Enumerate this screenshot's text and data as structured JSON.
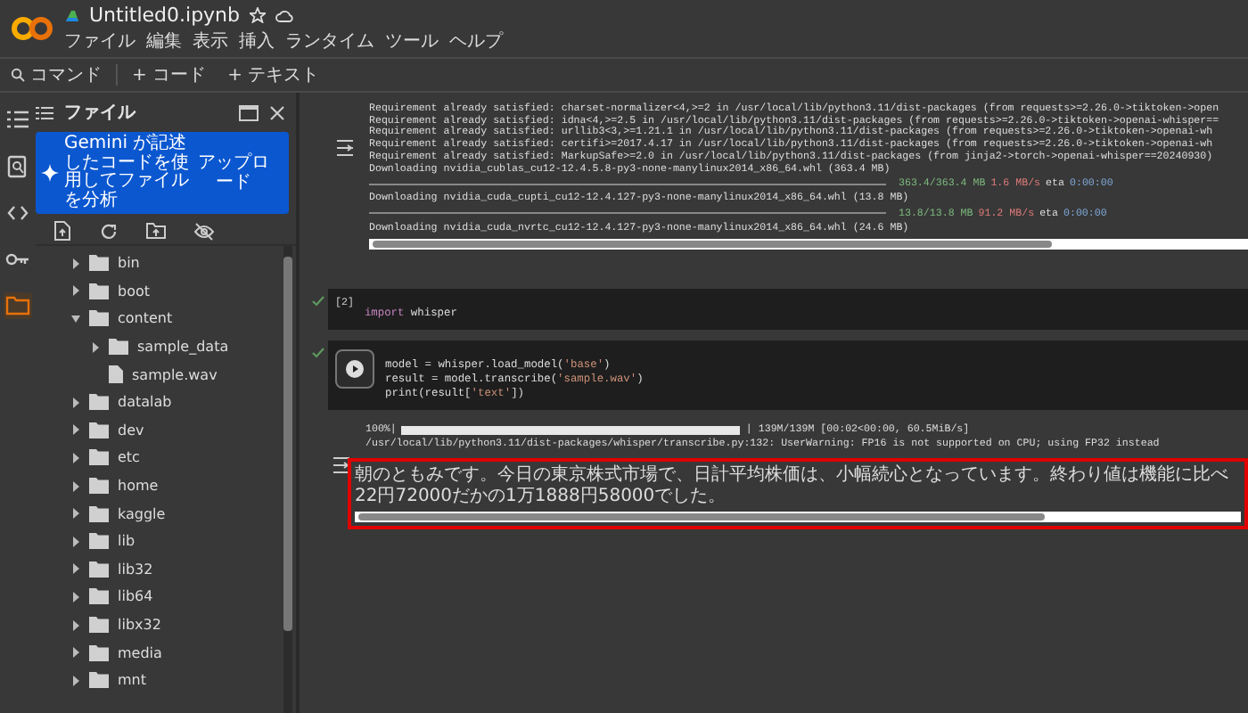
{
  "header": {
    "title": "Untitled0.ipynb",
    "menu": [
      "ファイル",
      "編集",
      "表示",
      "挿入",
      "ランタイム",
      "ツール",
      "ヘルプ"
    ]
  },
  "toolbar": {
    "command": "コマンド",
    "buttons": [
      "+ コード",
      "+ テキスト"
    ]
  },
  "activity_bar": [
    {
      "kind": "toc",
      "selected": false
    },
    {
      "kind": "find",
      "selected": false
    },
    {
      "kind": "code",
      "selected": false
    },
    {
      "kind": "key",
      "selected": false
    },
    {
      "kind": "folder",
      "selected": true
    }
  ],
  "file_panel": {
    "title": "ファイル",
    "gemini": {
      "text": "Gemini が記述したコードを使用してファイルを分析",
      "button": "アップロード"
    },
    "tree": [
      {
        "name": "bin",
        "kind": "folder",
        "expanded": false
      },
      {
        "name": "boot",
        "kind": "folder",
        "expanded": false
      },
      {
        "name": "content",
        "kind": "folder",
        "expanded": true,
        "children": [
          {
            "name": "sample_data",
            "kind": "folder",
            "expanded": false
          },
          {
            "name": "sample.wav",
            "kind": "file"
          }
        ]
      },
      {
        "name": "datalab",
        "kind": "folder",
        "expanded": false
      },
      {
        "name": "dev",
        "kind": "folder",
        "expanded": false
      },
      {
        "name": "etc",
        "kind": "folder",
        "expanded": false
      },
      {
        "name": "home",
        "kind": "folder",
        "expanded": false
      },
      {
        "name": "kaggle",
        "kind": "folder",
        "expanded": false
      },
      {
        "name": "lib",
        "kind": "folder",
        "expanded": false
      },
      {
        "name": "lib32",
        "kind": "folder",
        "expanded": false
      },
      {
        "name": "lib64",
        "kind": "folder",
        "expanded": false
      },
      {
        "name": "libx32",
        "kind": "folder",
        "expanded": false
      },
      {
        "name": "media",
        "kind": "folder",
        "expanded": false
      },
      {
        "name": "mnt",
        "kind": "folder",
        "expanded": false
      }
    ]
  },
  "cells": [
    {
      "kind": "output",
      "lines": [
        {
          "kind": "text",
          "text": "Requirement already satisfied: charset-normalizer<4,>=2 in /usr/local/lib/python3.11/dist-packages (from requests>=2.26.0->tiktoken->open"
        },
        {
          "kind": "text",
          "text": "Requirement already satisfied: idna<4,>=2.5 in /usr/local/lib/python3.11/dist-packages (from requests>=2.26.0->tiktoken->openai-whisper=="
        },
        {
          "kind": "text",
          "text": "Requirement already satisfied: urllib3<3,>=1.21.1 in /usr/local/lib/python3.11/dist-packages (from requests>=2.26.0->tiktoken->openai-wh"
        },
        {
          "kind": "text",
          "text": "Requirement already satisfied: certifi>=2017.4.17 in /usr/local/lib/python3.11/dist-packages (from requests>=2.26.0->tiktoken->openai-wh"
        },
        {
          "kind": "text",
          "text": "Requirement already satisfied: MarkupSafe>=2.0 in /usr/local/lib/python3.11/dist-packages (from jinja2->torch->openai-whisper==20240930)"
        },
        {
          "kind": "text",
          "text": "Downloading nvidia_cublas_cu12-12.4.5.8-py3-none-manylinux2014_x86_64.whl (363.4 MB)"
        },
        {
          "kind": "progress",
          "level": 1,
          "done": "363.4/363.4 MB",
          "speed": "1.6 MB/s",
          "eta_label": "eta",
          "eta": "0:00:00"
        },
        {
          "kind": "text",
          "text": "Downloading nvidia_cuda_cupti_cu12-12.4.127-py3-none-manylinux2014_x86_64.whl (13.8 MB)"
        },
        {
          "kind": "progress",
          "level": 1,
          "done": "13.8/13.8 MB",
          "speed": "91.2 MB/s",
          "eta_label": "eta",
          "eta": "0:00:00"
        },
        {
          "kind": "text",
          "text": "Downloading nvidia_cuda_nvrtc_cu12-12.4.127-py3-none-manylinux2014_x86_64.whl (24.6 MB)"
        }
      ]
    },
    {
      "kind": "code",
      "done": true,
      "prompt": "[2]",
      "code": [
        [
          {
            "kind": "kw",
            "text": "import"
          },
          {
            "kind": "plain",
            "text": " whisper"
          }
        ]
      ]
    },
    {
      "kind": "code",
      "done": true,
      "code": [
        [
          {
            "kind": "plain",
            "text": "model = whisper.load_model("
          },
          {
            "kind": "str",
            "text": "'base'"
          },
          {
            "kind": "plain",
            "text": ")"
          }
        ],
        [
          {
            "kind": "plain",
            "text": "result = model.transcribe("
          },
          {
            "kind": "str",
            "text": "'sample.wav'"
          },
          {
            "kind": "plain",
            "text": ")"
          }
        ],
        [
          {
            "kind": "plain",
            "text": "print(result["
          },
          {
            "kind": "str",
            "text": "'text'"
          },
          {
            "kind": "plain",
            "text": "])"
          }
        ]
      ],
      "output": {
        "progress_label": "100%|",
        "level": 1,
        "progress_info": "| 139M/139M [00:02<00:00, 60.5MiB/s]",
        "warning": "/usr/local/lib/python3.11/dist-packages/whisper/transcribe.py:132: UserWarning: FP16 is not supported on CPU; using FP32 instead",
        "result": "朝のともみです。今日の東京株式市場で、日計平均株価は、小幅続心となっています。終わり値は機能に比べ22円72000だかの1万1888円58000でした。",
        "highlighted": true
      }
    }
  ]
}
